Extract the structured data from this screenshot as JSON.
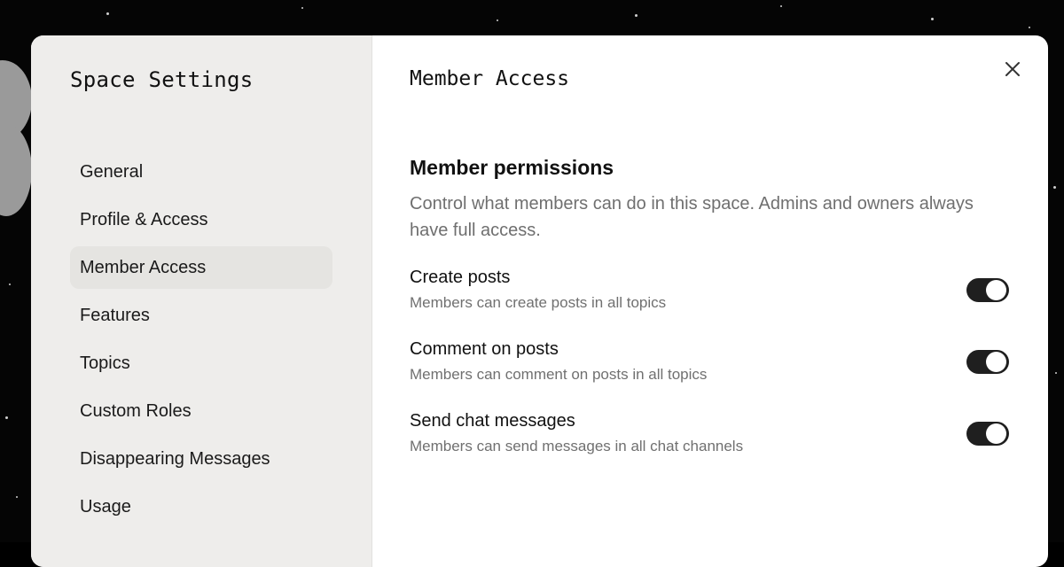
{
  "sidebar": {
    "title": "Space Settings",
    "items": [
      {
        "label": "General"
      },
      {
        "label": "Profile & Access"
      },
      {
        "label": "Member Access",
        "active": true
      },
      {
        "label": "Features"
      },
      {
        "label": "Topics"
      },
      {
        "label": "Custom Roles"
      },
      {
        "label": "Disappearing Messages"
      },
      {
        "label": "Usage"
      }
    ]
  },
  "main": {
    "title": "Member Access",
    "close_icon": "close-icon",
    "section": {
      "heading": "Member permissions",
      "description": "Control what members can do in this space. Admins and owners always have full access."
    },
    "permissions": [
      {
        "title": "Create posts",
        "description": "Members can create posts in all topics",
        "enabled": true
      },
      {
        "title": "Comment on posts",
        "description": "Members can comment on posts in all topics",
        "enabled": true
      },
      {
        "title": "Send chat messages",
        "description": "Members can send messages in all chat channels",
        "enabled": true
      }
    ]
  },
  "colors": {
    "sidebar_bg": "#eeedeb",
    "active_item_bg": "#e5e4e1",
    "toggle_on": "#1f1f1f",
    "muted_text": "#6f6f6f"
  }
}
